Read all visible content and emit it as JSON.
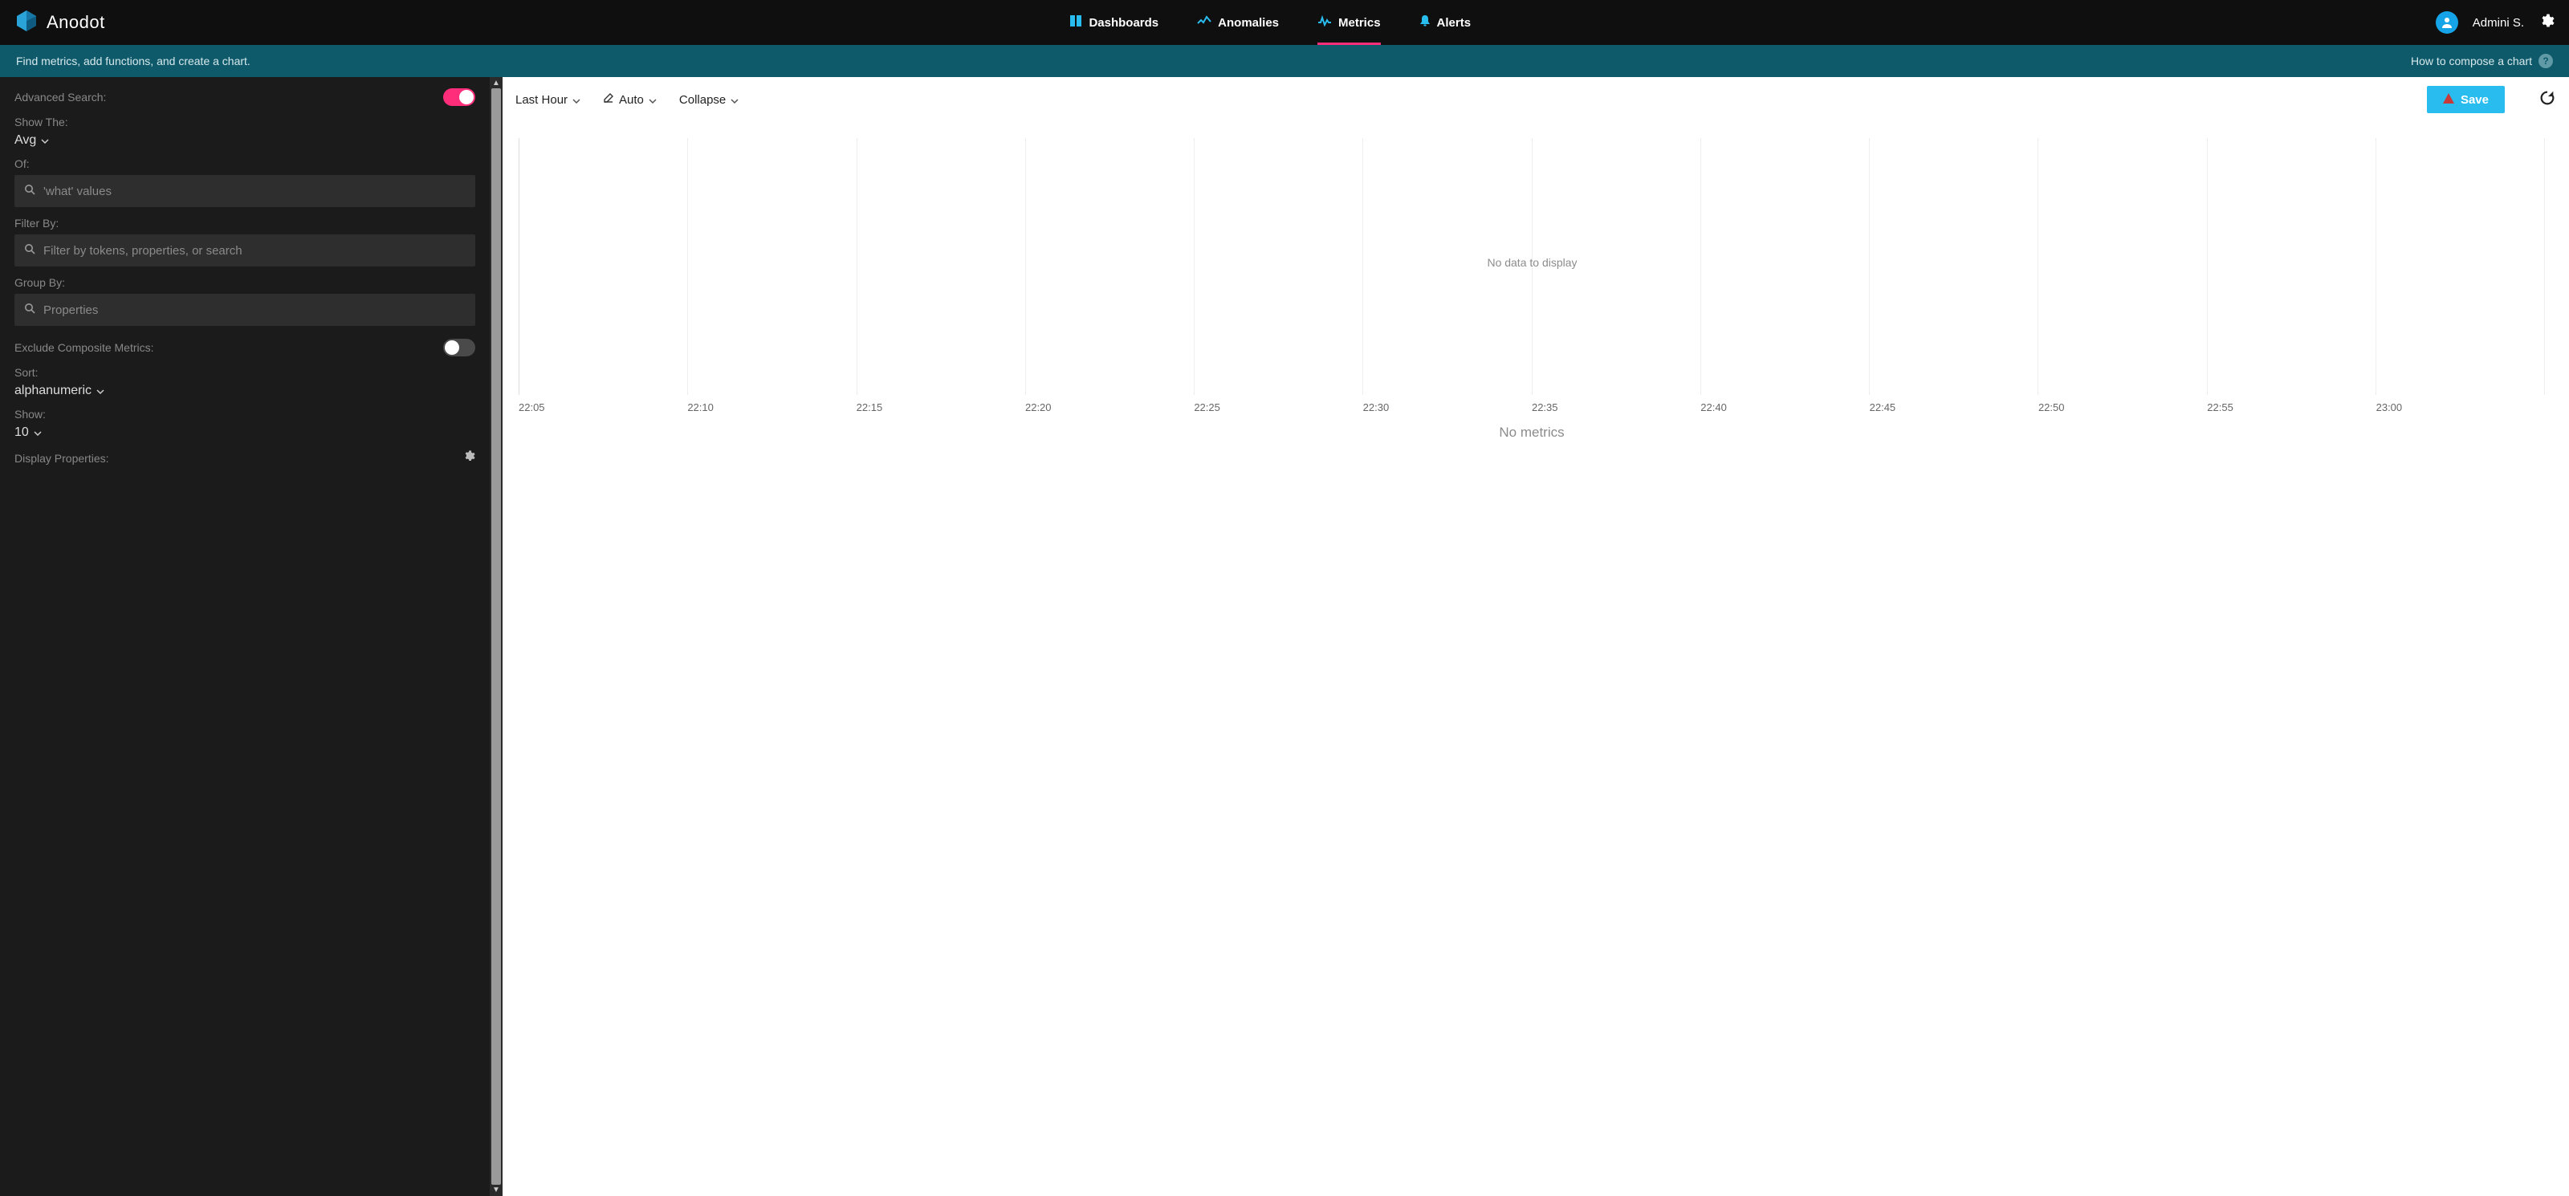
{
  "brand": {
    "name": "Anodot"
  },
  "nav": {
    "items": [
      {
        "label": "Dashboards",
        "icon": "dashboards"
      },
      {
        "label": "Anomalies",
        "icon": "anomalies"
      },
      {
        "label": "Metrics",
        "icon": "metrics",
        "active": true
      },
      {
        "label": "Alerts",
        "icon": "alerts"
      }
    ]
  },
  "user": {
    "name": "Admini S."
  },
  "subheader": {
    "left": "Find metrics, add functions, and create a chart.",
    "right": "How to compose a chart"
  },
  "sidebar": {
    "advanced_search_label": "Advanced Search:",
    "advanced_search_on": true,
    "show_the_label": "Show The:",
    "show_the_value": "Avg",
    "of_label": "Of:",
    "of_placeholder": "'what' values",
    "filter_by_label": "Filter By:",
    "filter_by_placeholder": "Filter by tokens, properties, or search",
    "group_by_label": "Group By:",
    "group_by_placeholder": "Properties",
    "exclude_label": "Exclude Composite Metrics:",
    "exclude_on": false,
    "sort_label": "Sort:",
    "sort_value": "alphanumeric",
    "show_label": "Show:",
    "show_value": "10",
    "display_props_label": "Display Properties:"
  },
  "content": {
    "time_range": "Last Hour",
    "auto": "Auto",
    "collapse": "Collapse",
    "save": "Save",
    "no_data": "No data to display",
    "no_metrics": "No metrics"
  },
  "chart_data": {
    "type": "line",
    "series": [],
    "x_ticks": [
      "22:05",
      "22:10",
      "22:15",
      "22:20",
      "22:25",
      "22:30",
      "22:35",
      "22:40",
      "22:45",
      "22:50",
      "22:55",
      "23:00"
    ],
    "title": "",
    "xlabel": "",
    "ylabel": ""
  }
}
